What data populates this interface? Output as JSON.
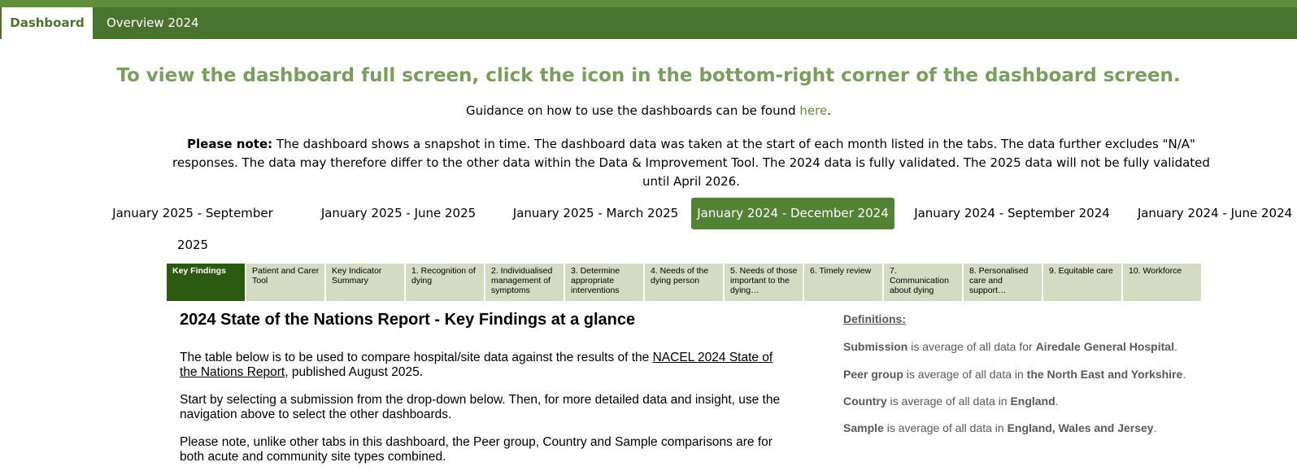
{
  "nav": {
    "tabs": [
      {
        "label": "Dashboard",
        "active": true
      },
      {
        "label": "Overview 2024",
        "active": false
      }
    ]
  },
  "headline": "To view the dashboard full screen, click the icon in the bottom-right corner of the dashboard screen.",
  "guidance": {
    "prefix": "Guidance on how to use the dashboards can be found ",
    "link": "here",
    "suffix": "."
  },
  "note": {
    "label": "Please note:",
    "text": " The dashboard shows a snapshot in time. The dashboard data was taken at the start of each month listed in the tabs. The data further excludes \"N/A\" responses. The data may therefore differ to the other data within the Data & Improvement Tool. The 2024 data is fully validated. The 2025 data will not be fully validated until April 2026."
  },
  "periods": [
    {
      "label": "January 2025 - September 2025",
      "active": false
    },
    {
      "label": "January 2025 - June 2025",
      "active": false
    },
    {
      "label": "January 2025 - March 2025",
      "active": false
    },
    {
      "label": "January 2024 - December 2024",
      "active": true
    },
    {
      "label": "January 2024 - September 2024",
      "active": false
    },
    {
      "label": "January 2024 - June 2024",
      "active": false
    }
  ],
  "dashboard_tabs": [
    {
      "label": "Key Findings",
      "active": true
    },
    {
      "label": "Patient and Carer Tool",
      "active": false
    },
    {
      "label": "Key Indicator Summary",
      "active": false
    },
    {
      "label": "1. Recognition of dying",
      "active": false
    },
    {
      "label": "2. Individualised management of symptoms",
      "active": false
    },
    {
      "label": "3. Determine appropriate interventions",
      "active": false
    },
    {
      "label": "4. Needs of the dying person",
      "active": false
    },
    {
      "label": "5. Needs of those important to the dying…",
      "active": false
    },
    {
      "label": "6. Timely review",
      "active": false
    },
    {
      "label": "7. Communication about dying",
      "active": false
    },
    {
      "label": "8. Personalised care and support…",
      "active": false
    },
    {
      "label": "9. Equitable care",
      "active": false
    },
    {
      "label": "10. Workforce",
      "active": false
    }
  ],
  "key_findings": {
    "title": "2024 State of the Nations Report - Key Findings at a glance",
    "p1_prefix": "The table below is to be used to compare hospital/site data against the results of the ",
    "p1_link": "NACEL 2024 State of the Nations Report",
    "p1_suffix": ", published August 2025.",
    "p2": "Start by selecting a submission from the drop-down below. Then, for more detailed data and insight, use the navigation above to select the other dashboards.",
    "p3": "Please note, unlike other tabs in this dashboard, the Peer group, Country and Sample comparisons are for both acute and community site types combined."
  },
  "definitions": {
    "title": "Definitions:",
    "items": [
      {
        "term": "Submission",
        "text": " is average of all data for ",
        "value": "Airedale General Hospital",
        "end": "."
      },
      {
        "term": "Peer group",
        "text": " is average of all data in ",
        "value": "the North East and Yorkshire",
        "end": "."
      },
      {
        "term": "Country",
        "text": " is average of all data in ",
        "value": "England",
        "end": "."
      },
      {
        "term": "Sample",
        "text": " is average of all data in ",
        "value": "England, Wales and Jersey",
        "end": "."
      }
    ]
  }
}
